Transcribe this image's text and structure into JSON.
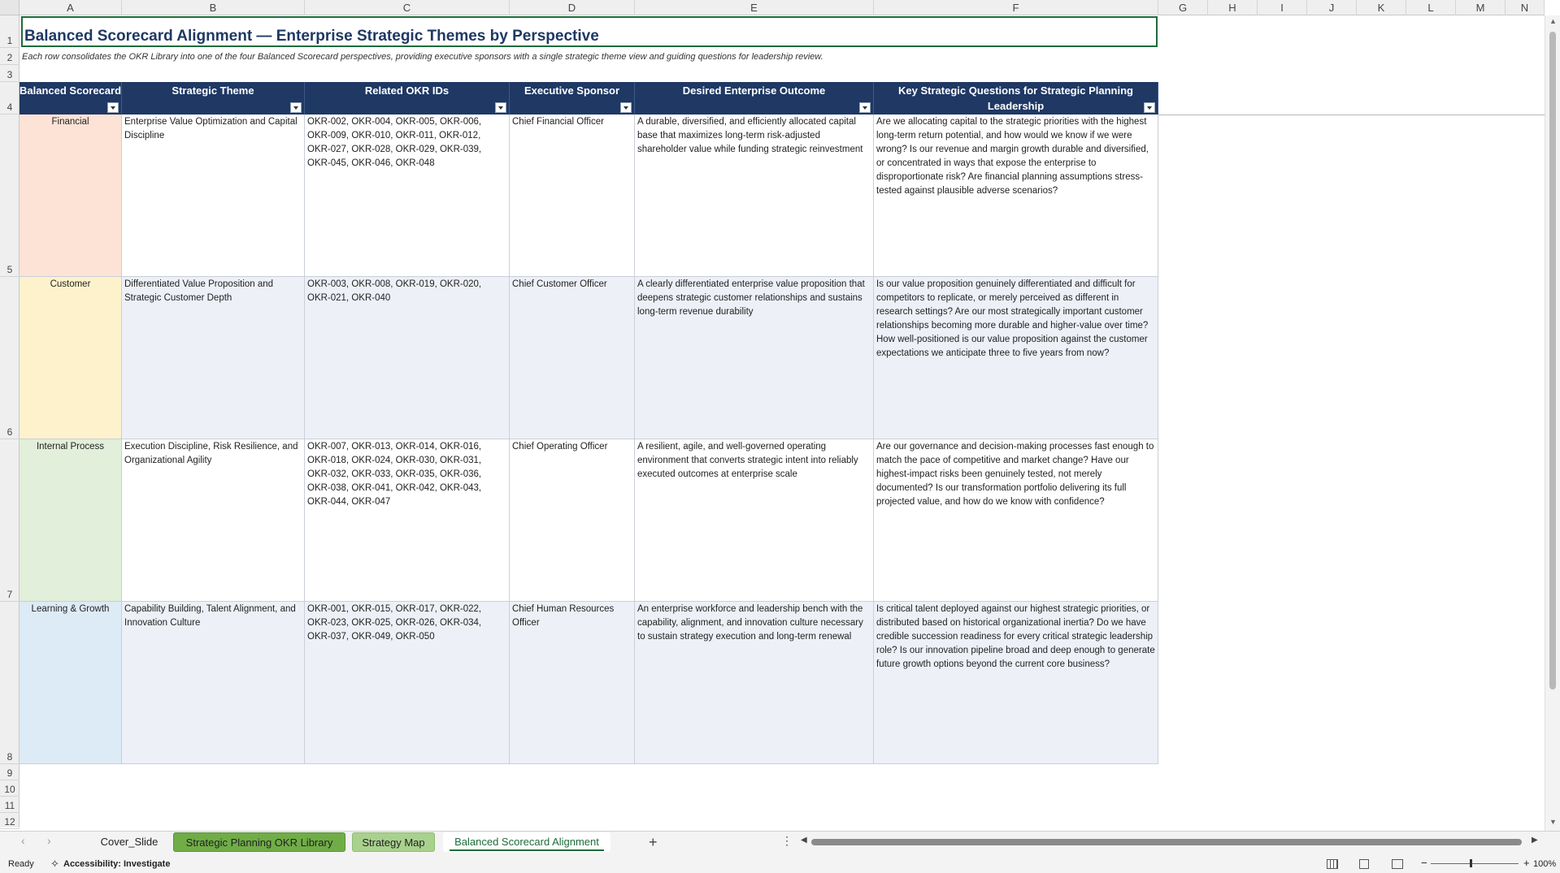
{
  "columns": [
    "A",
    "B",
    "C",
    "D",
    "E",
    "F",
    "G",
    "H",
    "I",
    "J",
    "K",
    "L",
    "M",
    "N"
  ],
  "rows": [
    "1",
    "2",
    "3",
    "4",
    "5",
    "6",
    "7",
    "8",
    "9",
    "10",
    "11",
    "12"
  ],
  "title": "Balanced Scorecard Alignment — Enterprise Strategic Themes by Perspective",
  "subtitle": "Each row consolidates the OKR Library into one of the four Balanced Scorecard perspectives, providing executive sponsors with a single strategic theme view and guiding questions for leadership review.",
  "headers": [
    "Balanced Scorecard",
    "Strategic Theme",
    "Related OKR IDs",
    "Executive Sponsor",
    "Desired Enterprise Outcome",
    "Key Strategic Questions for Strategic Planning Leadership"
  ],
  "table": [
    {
      "perspective": "Financial",
      "theme": "Enterprise Value Optimization and Capital Discipline",
      "okrs": "OKR-002, OKR-004, OKR-005, OKR-006, OKR-009, OKR-010, OKR-011, OKR-012, OKR-027, OKR-028, OKR-029, OKR-039, OKR-045, OKR-046, OKR-048",
      "sponsor": "Chief Financial Officer",
      "outcome": "A durable, diversified, and efficiently allocated capital base that maximizes long-term risk-adjusted shareholder value while funding strategic reinvestment",
      "questions": "Are we allocating capital to the strategic priorities with the highest long-term return potential, and how would we know if we were wrong? Is our revenue and margin growth durable and diversified, or concentrated in ways that expose the enterprise to disproportionate risk? Are financial planning assumptions stress-tested against plausible adverse scenarios?"
    },
    {
      "perspective": "Customer",
      "theme": "Differentiated Value Proposition and Strategic Customer Depth",
      "okrs": "OKR-003, OKR-008, OKR-019, OKR-020, OKR-021, OKR-040",
      "sponsor": "Chief Customer Officer",
      "outcome": "A clearly differentiated enterprise value proposition that deepens strategic customer relationships and sustains long-term revenue durability",
      "questions": "Is our value proposition genuinely differentiated and difficult for competitors to replicate, or merely perceived as different in research settings? Are our most strategically important customer relationships becoming more durable and higher-value over time? How well-positioned is our value proposition against the customer expectations we anticipate three to five years from now?"
    },
    {
      "perspective": "Internal Process",
      "theme": "Execution Discipline, Risk Resilience, and Organizational Agility",
      "okrs": "OKR-007, OKR-013, OKR-014, OKR-016, OKR-018, OKR-024, OKR-030, OKR-031, OKR-032, OKR-033, OKR-035, OKR-036, OKR-038, OKR-041, OKR-042, OKR-043, OKR-044, OKR-047",
      "sponsor": "Chief Operating Officer",
      "outcome": "A resilient, agile, and well-governed operating environment that converts strategic intent into reliably executed outcomes at enterprise scale",
      "questions": "Are our governance and decision-making processes fast enough to match the pace of competitive and market change? Have our highest-impact risks been genuinely tested, not merely documented? Is our transformation portfolio delivering its full projected value, and how do we know with confidence?"
    },
    {
      "perspective": "Learning & Growth",
      "theme": "Capability Building, Talent Alignment, and Innovation Culture",
      "okrs": "OKR-001, OKR-015, OKR-017, OKR-022, OKR-023, OKR-025, OKR-026, OKR-034, OKR-037, OKR-049, OKR-050",
      "sponsor": "Chief Human Resources Officer",
      "outcome": "An enterprise workforce and leadership bench with the capability, alignment, and innovation culture necessary to sustain strategy execution and long-term renewal",
      "questions": "Is critical talent deployed against our highest strategic priorities, or distributed based on historical organizational inertia? Do we have credible succession readiness for every critical strategic leadership role? Is our innovation pipeline broad and deep enough to generate future growth options beyond the current core business?"
    }
  ],
  "perspective_colors": [
    "#fde3d6",
    "#fdf2cc",
    "#e2efda",
    "#ddebf7"
  ],
  "accent": "#1f3864",
  "sheet_tabs": [
    "Cover_Slide",
    "Strategic Planning OKR Library",
    "Strategy Map",
    "Balanced Scorecard Alignment"
  ],
  "add_sheet_label": "+",
  "status": {
    "ready": "Ready",
    "accessibility": "Accessibility: Investigate",
    "zoom": "100%"
  }
}
